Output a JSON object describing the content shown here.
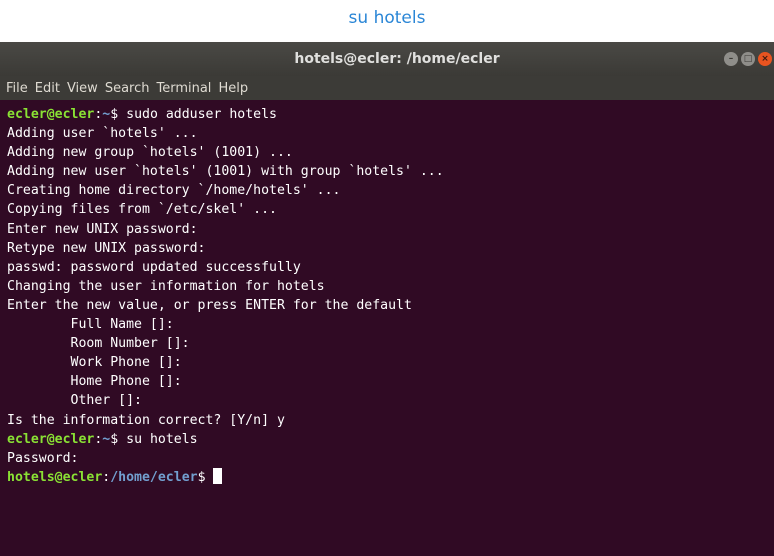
{
  "caption": "su hotels",
  "window": {
    "title": "hotels@ecler: /home/ecler",
    "buttons": [
      "minimize-icon",
      "maximize-icon",
      "close-icon"
    ]
  },
  "menu": [
    "File",
    "Edit",
    "View",
    "Search",
    "Terminal",
    "Help"
  ],
  "terminal": {
    "prompt1": {
      "userhost": "ecler@ecler",
      "sep": ":",
      "path": "~",
      "end": "$ ",
      "cmd": "sudo adduser hotels"
    },
    "output1": [
      "Adding user `hotels' ...",
      "Adding new group `hotels' (1001) ...",
      "Adding new user `hotels' (1001) with group `hotels' ...",
      "Creating home directory `/home/hotels' ...",
      "Copying files from `/etc/skel' ...",
      "Enter new UNIX password:",
      "Retype new UNIX password:",
      "passwd: password updated successfully",
      "Changing the user information for hotels",
      "Enter the new value, or press ENTER for the default",
      "        Full Name []:",
      "        Room Number []:",
      "        Work Phone []:",
      "        Home Phone []:",
      "        Other []:",
      "Is the information correct? [Y/n] y"
    ],
    "prompt2": {
      "userhost": "ecler@ecler",
      "sep": ":",
      "path": "~",
      "end": "$ ",
      "cmd": "su hotels"
    },
    "output2": [
      "Password:"
    ],
    "prompt3": {
      "userhost": "hotels@ecler",
      "sep": ":",
      "path": "/home/ecler",
      "end": "$ ",
      "cmd": ""
    }
  },
  "colors": {
    "terminal_bg": "#300a24",
    "prompt_user": "#8ae234",
    "prompt_path": "#729fcf",
    "caption": "#2a86d6"
  }
}
